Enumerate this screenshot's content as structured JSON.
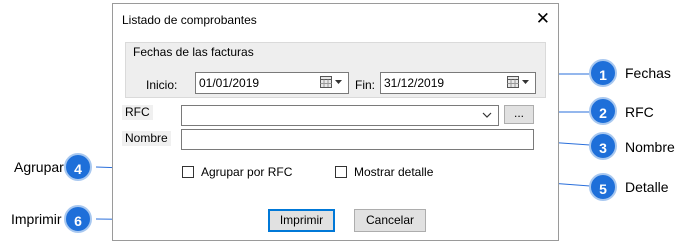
{
  "dialog": {
    "title": "Listado de comprobantes",
    "close_glyph": "✕"
  },
  "dates": {
    "group_title": "Fechas de las facturas",
    "start_label": "Inicio:",
    "start_value": "01/01/2019",
    "end_label": "Fin:",
    "end_value": "31/12/2019"
  },
  "rfc": {
    "label": "RFC",
    "value": "",
    "browse_label": "..."
  },
  "nombre": {
    "label": "Nombre",
    "value": ""
  },
  "options": {
    "group_by_rfc": "Agrupar por RFC",
    "show_detail": "Mostrar detalle"
  },
  "buttons": {
    "print": "Imprimir",
    "cancel": "Cancelar"
  },
  "callouts": [
    {
      "number": "1",
      "label": "Fechas"
    },
    {
      "number": "2",
      "label": "RFC"
    },
    {
      "number": "3",
      "label": "Nombre"
    },
    {
      "number": "4",
      "label": "Agrupar"
    },
    {
      "number": "5",
      "label": "Detalle"
    },
    {
      "number": "6",
      "label": "Imprimir"
    }
  ],
  "colors": {
    "badge": "#1e6fd9",
    "focus": "#0078d7"
  }
}
